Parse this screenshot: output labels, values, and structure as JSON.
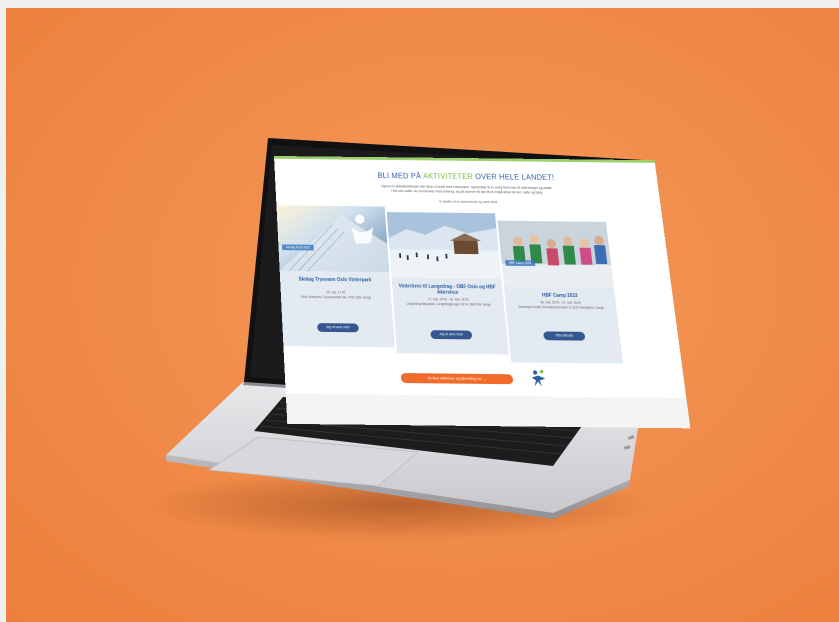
{
  "screen": {
    "headline_pre": "BLI MED PÅ",
    "headline_highlight": "AKTIVITETER",
    "headline_post": "OVER HELE LANDET!",
    "intro_line1": "Gjennom aktivitetstilbudet vårt tilbyr vi bredt med mennesker, og kanskje få et smilg fleire kan få utfordringer og støtte.",
    "intro_line2": "Hos oss møter du mennesker med erfaring, og på samme tid kan få et inngå såner lik det, nytte og hjelp.",
    "note": "Vi ønsker at du skal komme og være med!",
    "cards": [
      {
        "tag": "Skidag Trysil 2023",
        "title": "Skidag Trysvann Oslo Vinterpark",
        "date": "15. mar, 17:00",
        "address": "Oslo Vinterpark, Tryvannsveien 64, 0791 Oslo, Norge",
        "button": "Jeg vil være med!"
      },
      {
        "tag": "",
        "title": "Vinterbrev til Langedrag - OBF Oslo og HBF Akershus",
        "date": "17. mar, 10:00 - 18. mar, 14:00",
        "address": "Langedrag Naturpark, Langedragsvegen 3474, 3640 Flå, Norge",
        "button": "Jeg vil være med!"
      },
      {
        "tag": "HBF Camp 2023",
        "title": "HBF Camp 2023",
        "date": "18. mar, 16:00 - 21. mai, 16:00",
        "address": "Sandefjord hotell, Strandpromenaden 9, 3225 Sandefjord, Norge",
        "button": "Påbe tilbudet"
      }
    ],
    "cta": "Se flere aktiviteter og påmelding her →"
  },
  "colors": {
    "background": "#f08a48",
    "accent_blue": "#2c5e9e",
    "accent_green": "#6bbf3a",
    "cta_orange": "#f06a2a",
    "button_blue": "#34578f"
  }
}
